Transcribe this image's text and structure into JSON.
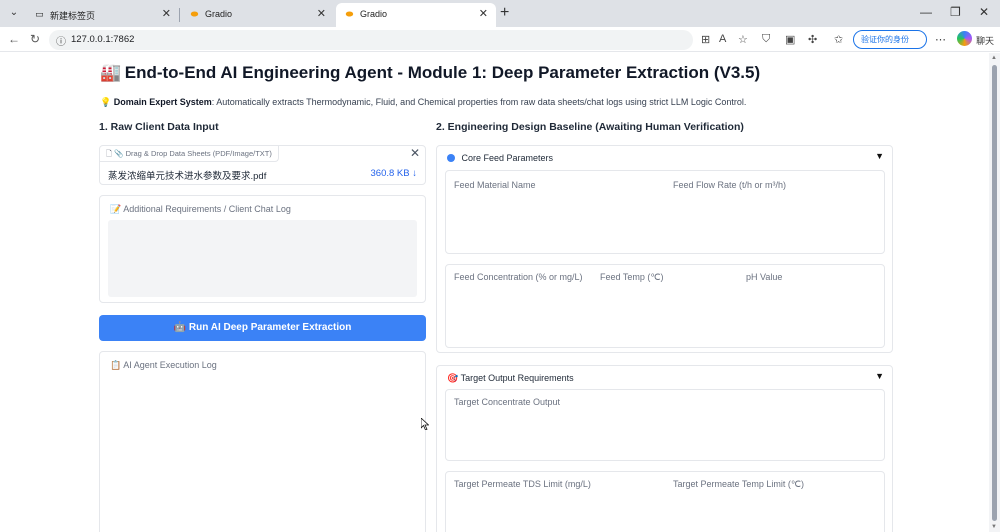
{
  "browser": {
    "tabs": [
      {
        "title": "新建标签页",
        "favicon": "newtab-icon"
      },
      {
        "title": "Gradio",
        "favicon": "gradio-icon"
      },
      {
        "title": "Gradio",
        "favicon": "gradio-icon"
      }
    ],
    "url": "127.0.0.1:7862",
    "verify_label": "验证你的身份",
    "chat_label": "聊天"
  },
  "page": {
    "title_emoji": "🏭",
    "title": "End-to-End AI Engineering Agent - Module 1: Deep Parameter Extraction (V3.5)",
    "desc_emoji": "💡",
    "desc_bold": "Domain Expert System",
    "desc_text": ": Automatically extracts Thermodynamic, Fluid, and Chemical properties from raw data sheets/chat logs using strict LLM Logic Control."
  },
  "left": {
    "section_title": "1. Raw Client Data Input",
    "file_label": "Drag & Drop Data Sheets (PDF/Image/TXT)",
    "file_name": "蒸发浓缩单元技术进水参数及要求.pdf",
    "file_size": "360.8 KB ↓",
    "chat_label": "Additional Requirements / Client Chat Log",
    "chat_value": "",
    "run_button": "Run AI Deep Parameter Extraction",
    "log_label": "AI Agent Execution Log"
  },
  "right": {
    "section_title": "2. Engineering Design Baseline (Awaiting Human Verification)",
    "core_feed": {
      "title": "Core Feed Parameters",
      "feed_material_name": "Feed Material Name",
      "feed_flow_rate": "Feed Flow Rate (t/h or m³/h)",
      "feed_concentration": "Feed Concentration (% or mg/L)",
      "feed_temp": "Feed Temp (℃)",
      "ph_value": "pH Value"
    },
    "target_output": {
      "title": "Target Output Requirements",
      "target_concentrate": "Target Concentrate Output",
      "target_permeate_tds": "Target Permeate TDS Limit (mg/L)",
      "target_permeate_temp": "Target Permeate Temp Limit (℃)"
    }
  }
}
